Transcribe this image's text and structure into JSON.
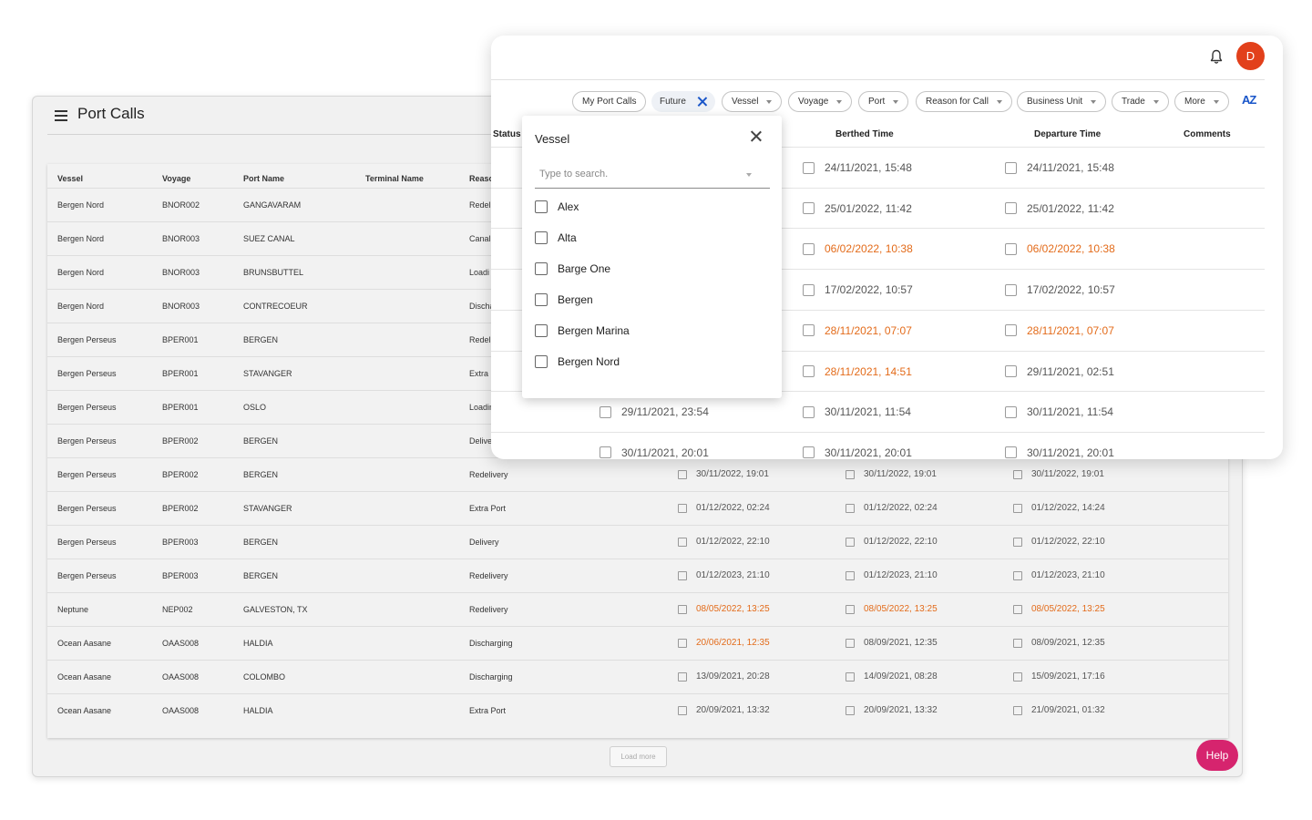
{
  "back_window": {
    "title": "Port Calls",
    "columns": [
      "Vessel",
      "Voyage",
      "Port Name",
      "Terminal Name",
      "Reaso"
    ],
    "rows": [
      {
        "vessel": "Bergen Nord",
        "voyage": "BNOR002",
        "port": "GANGAVARAM",
        "reason": "Redeli",
        "d1": "",
        "d2": "",
        "d3": "",
        "o1": false,
        "o2": false,
        "o3": false
      },
      {
        "vessel": "Bergen Nord",
        "voyage": "BNOR003",
        "port": "SUEZ CANAL",
        "reason": "Canal",
        "d1": "",
        "d2": "",
        "d3": "",
        "o1": false,
        "o2": false,
        "o3": false
      },
      {
        "vessel": "Bergen Nord",
        "voyage": "BNOR003",
        "port": "BRUNSBUTTEL",
        "reason": "Loadi",
        "d1": "",
        "d2": "",
        "d3": "",
        "o1": false,
        "o2": false,
        "o3": false
      },
      {
        "vessel": "Bergen Nord",
        "voyage": "BNOR003",
        "port": "CONTRECOEUR",
        "reason": "Discha",
        "d1": "",
        "d2": "",
        "d3": "",
        "o1": false,
        "o2": false,
        "o3": false
      },
      {
        "vessel": "Bergen Perseus",
        "voyage": "BPER001",
        "port": "BERGEN",
        "reason": "Redeli",
        "d1": "",
        "d2": "",
        "d3": "",
        "o1": false,
        "o2": false,
        "o3": false
      },
      {
        "vessel": "Bergen Perseus",
        "voyage": "BPER001",
        "port": "STAVANGER",
        "reason": "Extra I",
        "d1": "",
        "d2": "",
        "d3": "",
        "o1": false,
        "o2": false,
        "o3": false
      },
      {
        "vessel": "Bergen Perseus",
        "voyage": "BPER001",
        "port": "OSLO",
        "reason": "Loadir",
        "d1": "",
        "d2": "",
        "d3": "",
        "o1": false,
        "o2": false,
        "o3": false
      },
      {
        "vessel": "Bergen Perseus",
        "voyage": "BPER002",
        "port": "BERGEN",
        "reason": "Delive",
        "d1": "",
        "d2": "",
        "d3": "",
        "o1": false,
        "o2": false,
        "o3": false
      },
      {
        "vessel": "Bergen Perseus",
        "voyage": "BPER002",
        "port": "BERGEN",
        "reason": "Redelivery",
        "d1": "30/11/2022, 19:01",
        "d2": "30/11/2022, 19:01",
        "d3": "30/11/2022, 19:01",
        "o1": false,
        "o2": false,
        "o3": false
      },
      {
        "vessel": "Bergen Perseus",
        "voyage": "BPER002",
        "port": "STAVANGER",
        "reason": "Extra Port",
        "d1": "01/12/2022, 02:24",
        "d2": "01/12/2022, 02:24",
        "d3": "01/12/2022, 14:24",
        "o1": false,
        "o2": false,
        "o3": false
      },
      {
        "vessel": "Bergen Perseus",
        "voyage": "BPER003",
        "port": "BERGEN",
        "reason": "Delivery",
        "d1": "01/12/2022, 22:10",
        "d2": "01/12/2022, 22:10",
        "d3": "01/12/2022, 22:10",
        "o1": false,
        "o2": false,
        "o3": false
      },
      {
        "vessel": "Bergen Perseus",
        "voyage": "BPER003",
        "port": "BERGEN",
        "reason": "Redelivery",
        "d1": "01/12/2023, 21:10",
        "d2": "01/12/2023, 21:10",
        "d3": "01/12/2023, 21:10",
        "o1": false,
        "o2": false,
        "o3": false
      },
      {
        "vessel": "Neptune",
        "voyage": "NEP002",
        "port": "GALVESTON, TX",
        "reason": "Redelivery",
        "d1": "08/05/2022, 13:25",
        "d2": "08/05/2022, 13:25",
        "d3": "08/05/2022, 13:25",
        "o1": true,
        "o2": true,
        "o3": true
      },
      {
        "vessel": "Ocean Aasane",
        "voyage": "OAAS008",
        "port": "HALDIA",
        "reason": "Discharging",
        "d1": "20/06/2021, 12:35",
        "d2": "08/09/2021, 12:35",
        "d3": "08/09/2021, 12:35",
        "o1": true,
        "o2": false,
        "o3": false
      },
      {
        "vessel": "Ocean Aasane",
        "voyage": "OAAS008",
        "port": "COLOMBO",
        "reason": "Discharging",
        "d1": "13/09/2021, 20:28",
        "d2": "14/09/2021, 08:28",
        "d3": "15/09/2021, 17:16",
        "o1": false,
        "o2": false,
        "o3": false
      },
      {
        "vessel": "Ocean Aasane",
        "voyage": "OAAS008",
        "port": "HALDIA",
        "reason": "Extra Port",
        "d1": "20/09/2021, 13:32",
        "d2": "20/09/2021, 13:32",
        "d3": "21/09/2021, 01:32",
        "o1": false,
        "o2": false,
        "o3": false
      }
    ],
    "load_more": "Load more",
    "help": "Help"
  },
  "front_window": {
    "avatar_letter": "D",
    "filters": [
      "My Port Calls",
      "Future",
      "Vessel",
      "Voyage",
      "Port",
      "Reason for Call",
      "Business Unit",
      "Trade",
      "More"
    ],
    "sort_label": "AZ",
    "columns": [
      "Status",
      "Berthed Time",
      "Departure Time",
      "Comments"
    ],
    "rows": [
      {
        "a": "",
        "b": "24/11/2021, 15:48",
        "c": "24/11/2021, 15:48",
        "ob": false,
        "oc": false
      },
      {
        "a": "",
        "b": "25/01/2022, 11:42",
        "c": "25/01/2022, 11:42",
        "ob": false,
        "oc": false
      },
      {
        "a": "",
        "b": "06/02/2022, 10:38",
        "c": "06/02/2022, 10:38",
        "ob": true,
        "oc": true
      },
      {
        "a": "",
        "b": "17/02/2022, 10:57",
        "c": "17/02/2022, 10:57",
        "ob": false,
        "oc": false
      },
      {
        "a": "",
        "b": "28/11/2021, 07:07",
        "c": "28/11/2021, 07:07",
        "ob": true,
        "oc": true
      },
      {
        "a": "",
        "b": "28/11/2021, 14:51",
        "c": "29/11/2021, 02:51",
        "ob": true,
        "oc": false
      },
      {
        "a": "29/11/2021, 23:54",
        "b": "30/11/2021, 11:54",
        "c": "30/11/2021, 11:54",
        "ob": false,
        "oc": false
      },
      {
        "a": "30/11/2021, 20:01",
        "b": "30/11/2021, 20:01",
        "c": "30/11/2021, 20:01",
        "ob": false,
        "oc": false
      }
    ],
    "orange": "#e36b1a"
  },
  "vessel_dropdown": {
    "title": "Vessel",
    "search_placeholder": "Type to search.",
    "options": [
      "Alex",
      "Alta",
      "Barge One",
      "Bergen",
      "Bergen Marina",
      "Bergen Nord"
    ]
  },
  "colors": {
    "accent": "#1a56c9",
    "avatar": "#e2401b",
    "help": "#d6246e",
    "warning": "#e36b1a"
  }
}
